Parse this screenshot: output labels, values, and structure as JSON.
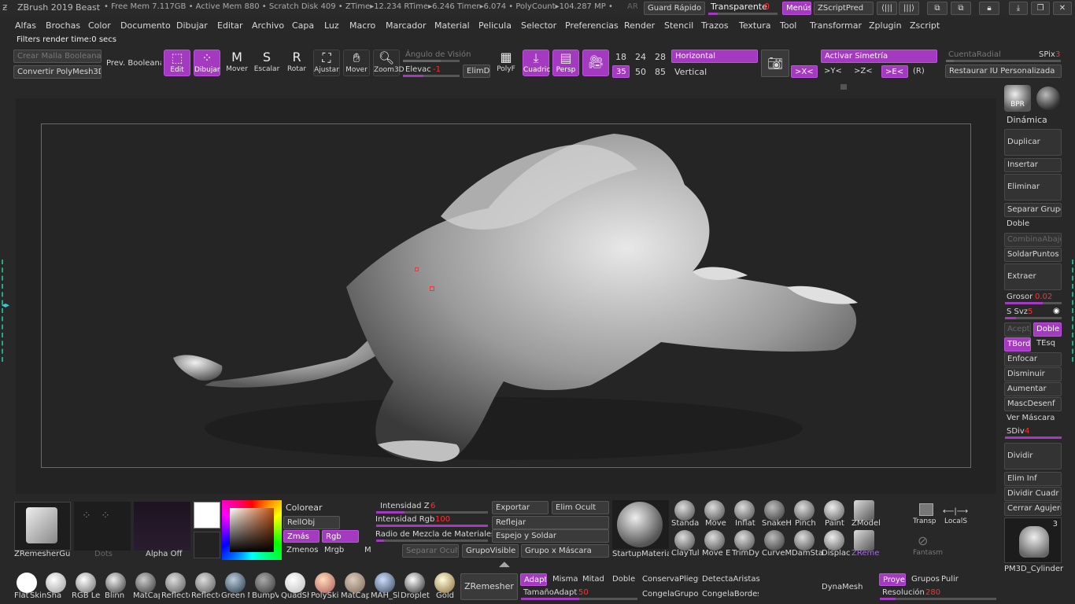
{
  "title_bar": {
    "app": "ZBrush 2019",
    "file": "Beast",
    "stats": "• Free Mem 7.117GB • Active Mem 880 • Scratch Disk 409 • ZTime▸12.234 RTime▸6.246 Timer▸6.074 • PolyCount▸104.287 MP •",
    "ar": "AR",
    "quicksave": "Guard Rápido",
    "transparency_label": "Transparente",
    "transparency_value": "0",
    "menus": "Menús",
    "script": "ZScriptPred"
  },
  "menu": [
    "Alfas",
    "Brochas",
    "Color",
    "Documento",
    "Dibujar",
    "Editar",
    "Archivo",
    "Capa",
    "Luz",
    "Macro",
    "Marcador",
    "Material",
    "Pelicula",
    "Selector",
    "Preferencias",
    "Render",
    "Stencil",
    "Trazos",
    "Textura",
    "Tool",
    "Transformar",
    "Zplugin",
    "Zscript"
  ],
  "status": "Filters render time:0 secs",
  "top_shelf": {
    "crear_malla": "Crear Malla Booleana",
    "prev_boolean": "Prev. Booleana",
    "convertir": "Convertir PolyMesh3D",
    "tools": [
      {
        "icon": "edit-icon",
        "label": "Edit",
        "active": true
      },
      {
        "icon": "draw-icon",
        "label": "Dibujar",
        "active": true
      },
      {
        "icon": "move-icon",
        "label": "Mover",
        "active": false
      },
      {
        "icon": "scale-icon",
        "label": "Escalar",
        "active": false
      },
      {
        "icon": "rotate-icon",
        "label": "Rotar",
        "active": false
      },
      {
        "icon": "frame-icon",
        "label": "Ajustar",
        "active": false
      },
      {
        "icon": "pan-icon",
        "label": "Mover",
        "active": false
      },
      {
        "icon": "zoom-icon",
        "label": "Zoom3D",
        "active": false
      }
    ],
    "angulo": "Ángulo de Visión",
    "elevac_label": "Elevac",
    "elevac_value": "-1",
    "elimdi": "ElimDi",
    "polyf": "PolyF",
    "cuadric": "Cuadric",
    "persp": "Persp",
    "nums_row1": [
      "18",
      "24",
      "28"
    ],
    "nums_row2": [
      "35",
      "50",
      "85"
    ],
    "horizontal": "Horizontal",
    "vertical": "Vertical",
    "activar_simetria": "Activar Simetría",
    "axes": [
      ">X<",
      ">Y<",
      ">Z<",
      ">E<",
      "(R)"
    ],
    "cuenta_radial": "CuentaRadial",
    "spix_label": "SPix",
    "spix_value": "3",
    "restaurar": "Restaurar IU Personalizada"
  },
  "right_panel": {
    "bpr": "BPR",
    "dinamica": "Dinámica",
    "duplicar": "Duplicar",
    "insertar": "Insertar",
    "eliminar": "Eliminar",
    "separar_grupo": "Separar Grupo",
    "doble_label": "Doble",
    "combina": "CombinaAbajo",
    "soldar": "SoldarPuntos",
    "extraer": "Extraer",
    "grosor_label": "Grosor",
    "grosor_value": "0.02",
    "ssvz_label": "S Svz",
    "ssvz_value": "5",
    "acept": "Acept",
    "doble": "Doble",
    "tbord": "TBord",
    "tesq": "TEsq",
    "enfocar": "Enfocar",
    "disminuir": "Disminuir",
    "aumentar": "Aumentar",
    "mascdesenf": "MascDesenf",
    "ver_mascara": "Ver Máscara",
    "sdiv_label": "SDiv",
    "sdiv_value": "4",
    "dividir": "Dividir",
    "elim_inf": "Elim Inf",
    "dividir_cuadr": "Dividir Cuadr",
    "cerrar_agujero": "Cerrar Agujero",
    "pm3d_count": "3",
    "pm3d_label": "PM3D_Cylinder"
  },
  "bottom": {
    "zremesher_guide": "ZRemesherGui",
    "dots": "Dots",
    "alpha_off": "Alpha Off",
    "colorear": "Colorear",
    "rellobj": "RellObj",
    "zmas": "Zmás",
    "rgb": "Rgb",
    "zmenos": "Zmenos",
    "mrgb": "Mrgb",
    "m": "M",
    "intensidad_z_label": "Intensidad Z",
    "intensidad_z_value": "6",
    "intensidad_rgb_label": "Intensidad Rgb",
    "intensidad_rgb_value": "100",
    "radio_label": "Radio de Mezcla de Materiales",
    "separar_oculto": "Separar Oculto",
    "grupo_visible": "GrupoVisible",
    "grupo_mascara": "Grupo x Máscara",
    "exportar": "Exportar",
    "elim_ocult": "Elim Ocult",
    "reflejar": "Reflejar",
    "espejo_soldar": "Espejo y Soldar",
    "startup_material": "StartupMateria",
    "brushes_row1": [
      "Standar",
      "Move",
      "Inflat",
      "SnakeH",
      "Pinch",
      "Paint",
      "ZModel"
    ],
    "brushes_row2": [
      "ClayTul",
      "Move E",
      "TrimDy",
      "CurveM",
      "DamSta",
      "Displac",
      "ZReme"
    ],
    "transp": "Transp",
    "locals": "LocalS",
    "fantasma": "Fantasm",
    "materials": [
      "Flat Col",
      "SkinSha",
      "RGB Lev",
      "Blinn",
      "MatCap",
      "Reflecto",
      "Reflecto",
      "Green M",
      "BumpV",
      "QuadSh",
      "PolySkin",
      "MatCap",
      "MAH_Sh",
      "Droplet",
      "Gold"
    ],
    "zremesher": "ZRemesher",
    "adapt": "Adapt",
    "misma": "Misma",
    "mitad": "Mitad",
    "doble": "Doble",
    "conserva_plieg": "ConservaPliegu",
    "detecta_aristas": "DetectaAristas",
    "tamano_label": "TamañoAdapt",
    "tamano_value": "50",
    "congela_grupos": "CongelaGrupos",
    "congela_bordes": "CongelaBordes",
    "dynamesh": "DynaMesh",
    "proyec": "Proyec",
    "grupos": "Grupos",
    "pulir": "Pulir",
    "resolucion_label": "Resolución",
    "resolucion_value": "280"
  },
  "colors": {
    "accent": "#a33ac0",
    "bg": "#282828",
    "canvas": "#232323"
  }
}
